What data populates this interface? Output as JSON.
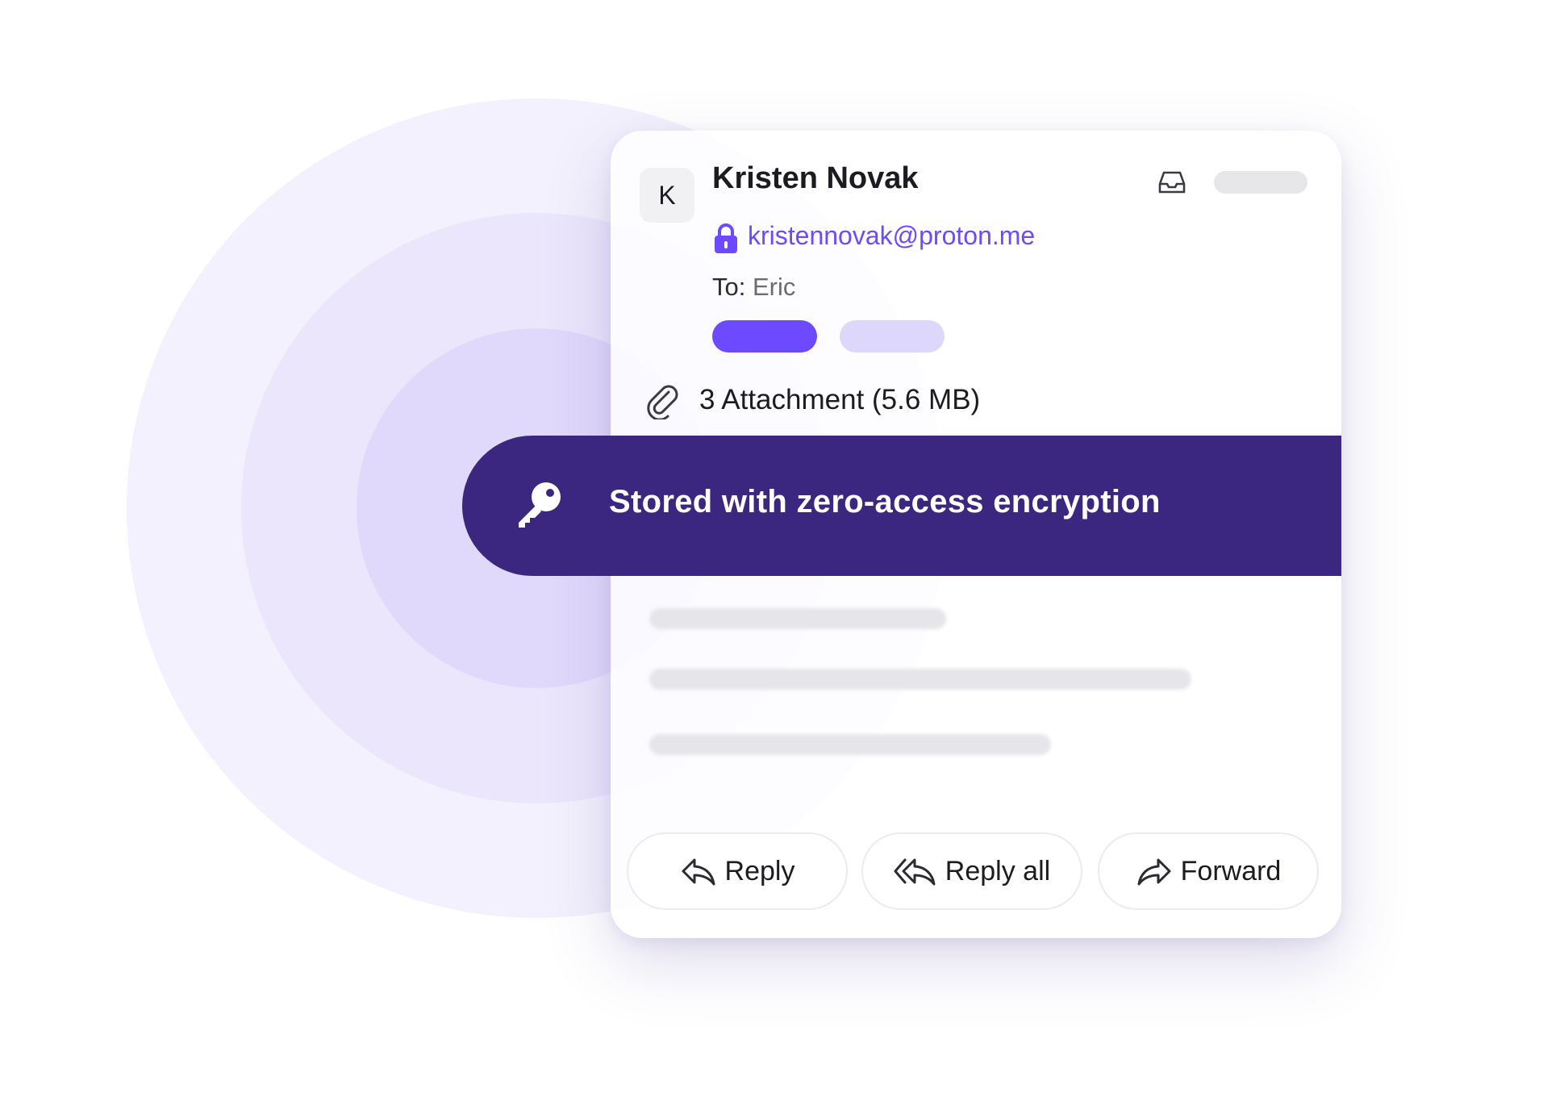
{
  "sender": {
    "avatar_initial": "K",
    "name": "Kristen Novak",
    "email": "kristennovak@proton.me"
  },
  "recipient": {
    "prefix": "To:",
    "name": "Eric"
  },
  "attachments": {
    "label": "3 Attachment (5.6 MB)"
  },
  "banner": {
    "text": "Stored with zero-access encryption"
  },
  "actions": {
    "reply": "Reply",
    "reply_all": "Reply all",
    "forward": "Forward"
  },
  "colors": {
    "accent": "#6d4aff",
    "banner_bg": "#3b2680",
    "ring_light": "#efecfd",
    "ring_mid": "#e6e0fb",
    "ring_inner": "#dcd4fa"
  },
  "icons": {
    "inbox": "inbox-icon",
    "lock": "lock-icon",
    "attachment": "paperclip-icon",
    "key": "key-icon",
    "reply": "reply-arrow-icon",
    "reply_all": "reply-all-arrow-icon",
    "forward": "forward-arrow-icon"
  }
}
